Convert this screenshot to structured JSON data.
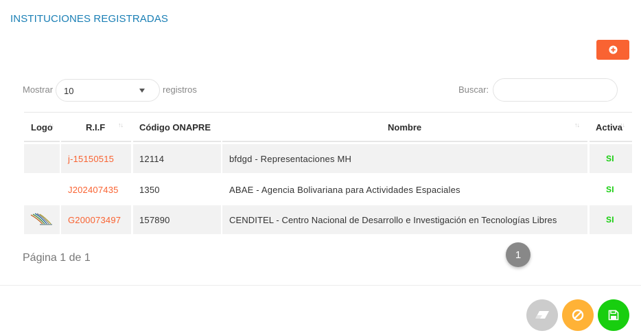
{
  "page": {
    "title": "INSTITUCIONES REGISTRADAS"
  },
  "toolbar": {
    "add_icon": "plus-circle-icon"
  },
  "controls": {
    "show_label": "Mostrar",
    "length_value": "10",
    "records_label": "registros",
    "search_label": "Buscar:",
    "search_value": ""
  },
  "table": {
    "columns": [
      {
        "label": "Logo"
      },
      {
        "label": "R.I.F"
      },
      {
        "label": "Código ONAPRE"
      },
      {
        "label": "Nombre"
      },
      {
        "label": "Activa"
      }
    ],
    "rows": [
      {
        "logo": "",
        "rif": "j-15150515",
        "onapre": "12114",
        "nombre": "bfdgd - Representaciones MH",
        "activa": "SI"
      },
      {
        "logo": "",
        "rif": "J202407435",
        "onapre": "1350",
        "nombre": "ABAE - Agencia Bolivariana para Actividades Espaciales",
        "activa": "SI"
      },
      {
        "logo": "cenditel-logo",
        "rif": "G200073497",
        "onapre": "157890",
        "nombre": "CENDITEL - Centro Nacional de Desarrollo e Investigación en Tecnologías Libres",
        "activa": "SI"
      }
    ]
  },
  "pagination": {
    "info": "Página 1 de 1",
    "current": "1"
  },
  "footer": {
    "clear_icon": "eraser-icon",
    "cancel_icon": "ban-icon",
    "save_icon": "floppy-disk-icon"
  },
  "colors": {
    "title": "#1a7fb5",
    "accent": "#f96332",
    "success": "#18ce0f",
    "warning": "#ffb236",
    "neutral": "#cccccc"
  }
}
